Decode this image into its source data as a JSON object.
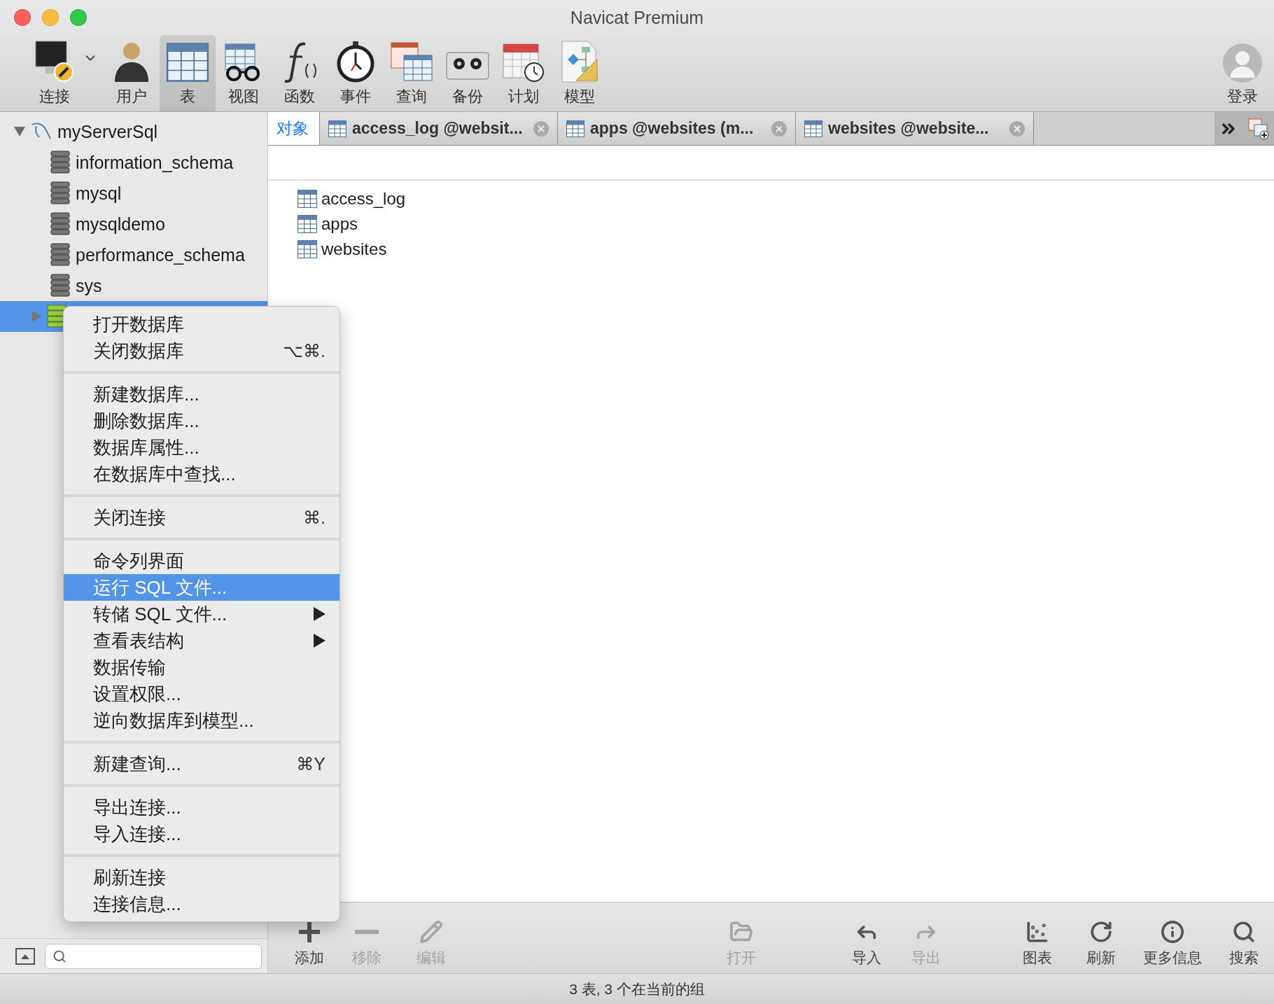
{
  "window": {
    "title": "Navicat Premium"
  },
  "toolbar": {
    "items": [
      {
        "label": "连接",
        "selected": false,
        "has_dropdown": true
      },
      {
        "label": "用户",
        "selected": false,
        "has_dropdown": false
      },
      {
        "label": "表",
        "selected": true,
        "has_dropdown": false
      },
      {
        "label": "视图",
        "selected": false,
        "has_dropdown": false
      },
      {
        "label": "函数",
        "selected": false,
        "has_dropdown": false
      },
      {
        "label": "事件",
        "selected": false,
        "has_dropdown": false
      },
      {
        "label": "查询",
        "selected": false,
        "has_dropdown": false
      },
      {
        "label": "备份",
        "selected": false,
        "has_dropdown": false
      },
      {
        "label": "计划",
        "selected": false,
        "has_dropdown": false
      },
      {
        "label": "模型",
        "selected": false,
        "has_dropdown": false
      }
    ],
    "login": {
      "label": "登录"
    }
  },
  "sidebar": {
    "connection": {
      "name": "myServerSql",
      "expanded": true
    },
    "databases": [
      {
        "name": "information_schema",
        "selected": false,
        "open": false
      },
      {
        "name": "mysql",
        "selected": false,
        "open": false
      },
      {
        "name": "mysqldemo",
        "selected": false,
        "open": false
      },
      {
        "name": "performance_schema",
        "selected": false,
        "open": false
      },
      {
        "name": "sys",
        "selected": false,
        "open": false
      },
      {
        "selected": true,
        "open": true
      }
    ]
  },
  "tabs": [
    {
      "label": "对象",
      "selected": true,
      "closable": false
    },
    {
      "label": "access_log @websit...",
      "selected": false,
      "closable": true
    },
    {
      "label": "apps @websites (m...",
      "selected": false,
      "closable": true
    },
    {
      "label": "websites @website...",
      "selected": false,
      "closable": true
    }
  ],
  "objects": [
    {
      "name": "access_log"
    },
    {
      "name": "apps"
    },
    {
      "name": "websites"
    }
  ],
  "context_menu": {
    "groups": [
      [
        {
          "label": "打开数据库",
          "selected": false,
          "has_submenu": false
        },
        {
          "label": "关闭数据库",
          "shortcut": "⌥⌘.",
          "selected": false,
          "has_submenu": false
        }
      ],
      [
        {
          "label": "新建数据库...",
          "selected": false,
          "has_submenu": false
        },
        {
          "label": "删除数据库...",
          "selected": false,
          "has_submenu": false
        },
        {
          "label": "数据库属性...",
          "selected": false,
          "has_submenu": false
        },
        {
          "label": "在数据库中查找...",
          "selected": false,
          "has_submenu": false
        }
      ],
      [
        {
          "label": "关闭连接",
          "shortcut": "⌘.",
          "selected": false,
          "has_submenu": false
        }
      ],
      [
        {
          "label": "命令列界面",
          "selected": false,
          "has_submenu": false
        },
        {
          "label": "运行 SQL 文件...",
          "selected": true,
          "has_submenu": false
        },
        {
          "label": "转储 SQL 文件...",
          "selected": false,
          "has_submenu": true
        },
        {
          "label": "查看表结构",
          "selected": false,
          "has_submenu": true
        },
        {
          "label": "数据传输",
          "selected": false,
          "has_submenu": false
        },
        {
          "label": "设置权限...",
          "selected": false,
          "has_submenu": false
        },
        {
          "label": "逆向数据库到模型...",
          "selected": false,
          "has_submenu": false
        }
      ],
      [
        {
          "label": "新建查询...",
          "shortcut": "⌘Y",
          "selected": false,
          "has_submenu": false
        }
      ],
      [
        {
          "label": "导出连接...",
          "selected": false,
          "has_submenu": false
        },
        {
          "label": "导入连接...",
          "selected": false,
          "has_submenu": false
        }
      ],
      [
        {
          "label": "刷新连接",
          "selected": false,
          "has_submenu": false
        },
        {
          "label": "连接信息...",
          "selected": false,
          "has_submenu": false
        }
      ]
    ]
  },
  "bottom_toolbar": [
    {
      "label": "添加",
      "disabled": false
    },
    {
      "label": "移除",
      "disabled": true
    },
    {
      "label": "编辑",
      "disabled": true
    },
    {
      "label": "打开",
      "disabled": true
    },
    {
      "label": "导入",
      "disabled": false
    },
    {
      "label": "导出",
      "disabled": true
    },
    {
      "label": "图表",
      "disabled": false
    },
    {
      "label": "刷新",
      "disabled": false
    },
    {
      "label": "更多信息",
      "disabled": false
    },
    {
      "label": "搜索",
      "disabled": false
    }
  ],
  "status_bar": "3 表, 3 个在当前的组"
}
